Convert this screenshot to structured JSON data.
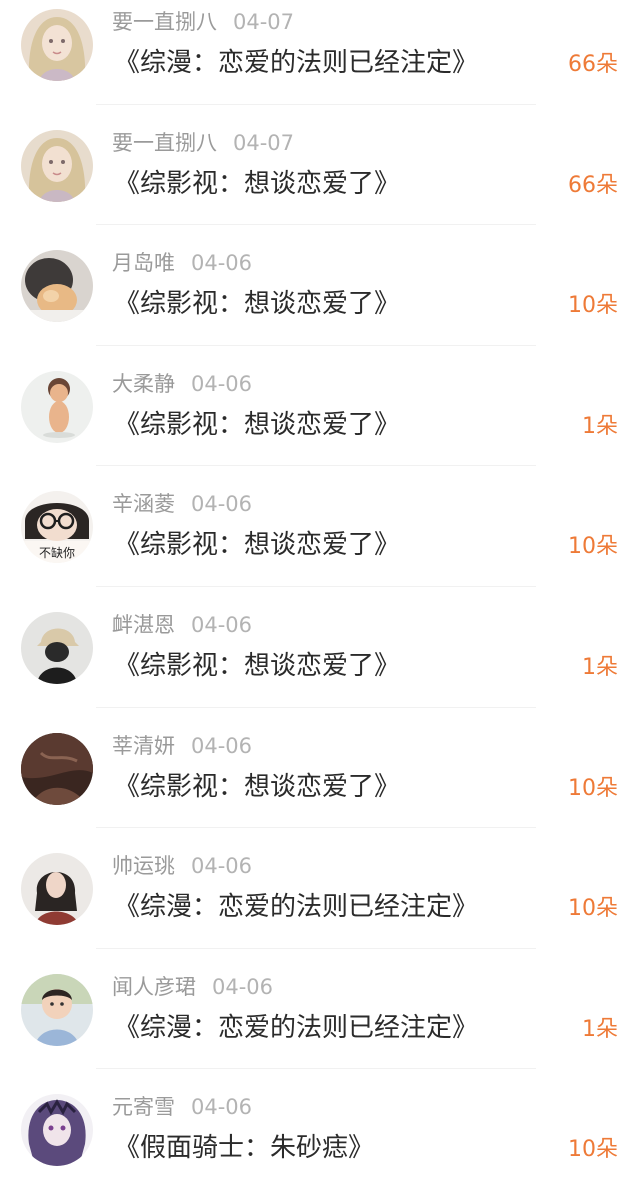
{
  "flower_color": "#ee7a37",
  "list": [
    {
      "user": "要一直捌八",
      "date": "04-07",
      "work": "《综漫：恋爱的法则已经注定》",
      "flowers": "66朵"
    },
    {
      "user": "要一直捌八",
      "date": "04-07",
      "work": "《综影视：想谈恋爱了》",
      "flowers": "66朵"
    },
    {
      "user": "月岛唯",
      "date": "04-06",
      "work": "《综影视：想谈恋爱了》",
      "flowers": "10朵"
    },
    {
      "user": "大柔静",
      "date": "04-06",
      "work": "《综影视：想谈恋爱了》",
      "flowers": "1朵"
    },
    {
      "user": "辛涵菱",
      "date": "04-06",
      "work": "《综影视：想谈恋爱了》",
      "flowers": "10朵",
      "avatar_text": "不缺你"
    },
    {
      "user": "衅湛恩",
      "date": "04-06",
      "work": "《综影视：想谈恋爱了》",
      "flowers": "1朵"
    },
    {
      "user": "莘清妍",
      "date": "04-06",
      "work": "《综影视：想谈恋爱了》",
      "flowers": "10朵"
    },
    {
      "user": "帅运珧",
      "date": "04-06",
      "work": "《综漫：恋爱的法则已经注定》",
      "flowers": "10朵"
    },
    {
      "user": "闻人彦珺",
      "date": "04-06",
      "work": "《综漫：恋爱的法则已经注定》",
      "flowers": "1朵"
    },
    {
      "user": "元寄雪",
      "date": "04-06",
      "work": "《假面骑士：朱砂痣》",
      "flowers": "10朵"
    }
  ]
}
